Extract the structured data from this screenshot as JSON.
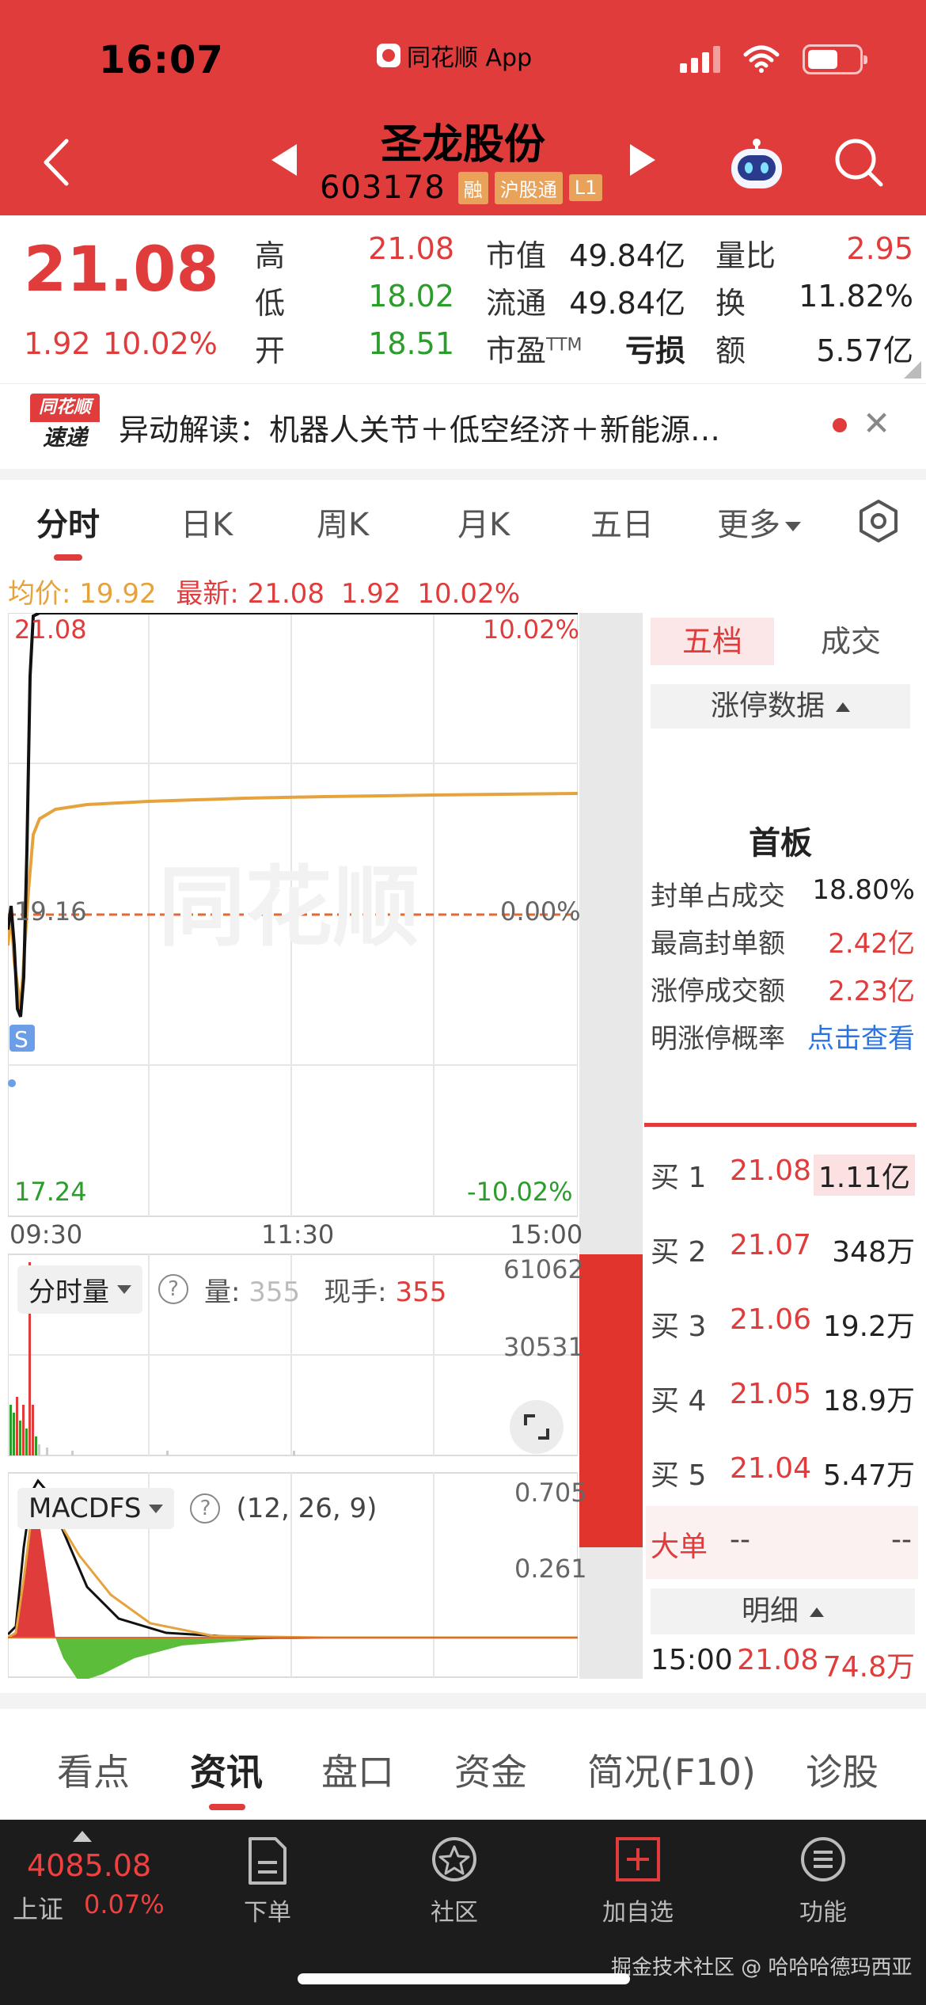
{
  "status_bar": {
    "time": "16:07",
    "app_label": "同花顺 App"
  },
  "header": {
    "stock_name": "圣龙股份",
    "stock_code": "603178",
    "tags": [
      "融",
      "沪股通",
      "L1"
    ]
  },
  "quote": {
    "price": "21.08",
    "change": "1.92",
    "change_pct": "10.02%",
    "rows": [
      {
        "l1": "高",
        "v1": "21.08",
        "l2": "市值",
        "v2": "49.84亿",
        "l3": "量比",
        "v3": "2.95"
      },
      {
        "l1": "低",
        "v1": "18.02",
        "l2": "流通",
        "v2": "49.84亿",
        "l3": "换",
        "v3": "11.82%"
      },
      {
        "l1": "开",
        "v1": "18.51",
        "l2": "市盈",
        "l2_sup": "TTM",
        "v2": "亏损",
        "l3": "额",
        "v3": "5.57亿"
      }
    ]
  },
  "news": {
    "logo_top": "同花顺",
    "logo_bottom": "速递",
    "text": "异动解读：机器人关节＋低空经济＋新能源…",
    "close": "✕"
  },
  "tabs": [
    {
      "label": "分时",
      "active": true
    },
    {
      "label": "日K"
    },
    {
      "label": "周K"
    },
    {
      "label": "月K"
    },
    {
      "label": "五日"
    },
    {
      "label": "更多"
    }
  ],
  "info_line": {
    "avg": "均价: 19.92",
    "latest": "最新: 21.08",
    "change": "1.92",
    "pct": "10.02%"
  },
  "chart_labels": {
    "top_price": "21.08",
    "top_pct": "10.02%",
    "mid_price": "19.16",
    "mid_pct": "0.00%",
    "bot_price": "17.24",
    "bot_pct": "-10.02%",
    "marker": "S",
    "watermark": "同花顺",
    "times": [
      "09:30",
      "11:30",
      "15:00"
    ]
  },
  "volume_panel": {
    "selector": "分时量",
    "help": "?",
    "vol_label": "量:",
    "vol_value": "355",
    "hand_label": "现手:",
    "hand_value": "355",
    "axis_top": "61062",
    "axis_mid": "30531"
  },
  "macd_panel": {
    "selector": "MACDFS",
    "help": "?",
    "params": "(12, 26, 9)",
    "axis_top": "0.705",
    "axis_mid": "0.261"
  },
  "orderbook": {
    "tab_active": "五档",
    "tab_other": "成交",
    "limit_header": "涨停数据",
    "first_board": "首板",
    "limit_rows": [
      {
        "label": "封单占成交",
        "value": "18.80%"
      },
      {
        "label": "最高封单额",
        "value": "2.42亿"
      },
      {
        "label": "涨停成交额",
        "value": "2.23亿"
      },
      {
        "label": "明涨停概率",
        "value": "点击查看"
      }
    ],
    "bids": [
      {
        "label": "买 1",
        "price": "21.08",
        "vol": "1.11亿"
      },
      {
        "label": "买 2",
        "price": "21.07",
        "vol": "348万"
      },
      {
        "label": "买 3",
        "price": "21.06",
        "vol": "19.2万"
      },
      {
        "label": "买 4",
        "price": "21.05",
        "vol": "18.9万"
      },
      {
        "label": "买 5",
        "price": "21.04",
        "vol": "5.47万"
      }
    ],
    "big_order": {
      "label": "大单",
      "a": "--",
      "b": "--"
    },
    "detail_header": "明细",
    "detail_row": {
      "time": "15:00",
      "price": "21.08",
      "vol": "74.8万"
    }
  },
  "bottom_tabs": [
    {
      "label": "看点"
    },
    {
      "label": "资讯",
      "active": true
    },
    {
      "label": "盘口"
    },
    {
      "label": "资金"
    },
    {
      "label": "简况(F10)"
    },
    {
      "label": "诊股"
    }
  ],
  "footer": {
    "index_value": "4085.08",
    "index_name": "上证",
    "index_pct": "0.07%",
    "items": [
      {
        "label": "下单",
        "icon": "order-icon"
      },
      {
        "label": "社区",
        "icon": "community-icon"
      },
      {
        "label": "加自选",
        "icon": "add-watchlist-icon"
      },
      {
        "label": "功能",
        "icon": "menu-icon"
      }
    ],
    "watermark": "掘金技术社区 @ 哈哈哈德玛西亚"
  },
  "colors": {
    "brand_red": "#e03c3c",
    "down_green": "#2a9d2a",
    "avg_orange": "#e6a23c",
    "link_blue": "#2b74e0"
  }
}
